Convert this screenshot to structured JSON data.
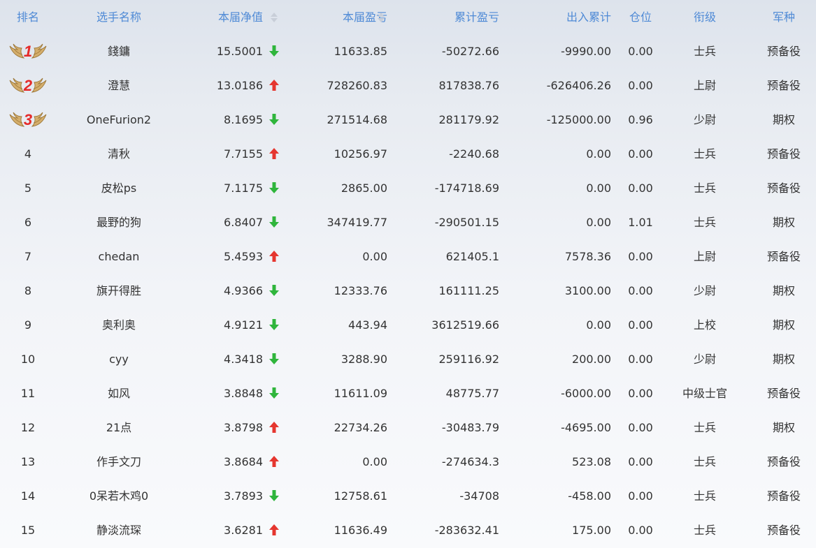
{
  "header": {
    "rank": "排名",
    "name": "选手名称",
    "nav": "本届净值",
    "pl": "本届盈亏",
    "cum": "累计盈亏",
    "io": "出入累计",
    "pos": "仓位",
    "rank_title": "衔级",
    "type": "军种"
  },
  "colors": {
    "header_text": "#4f8ad6",
    "up_arrow": "#e5362f",
    "down_arrow": "#2fb53c",
    "medal_number": "#e52a2a",
    "medal_wing": "#c9a15a"
  },
  "icons": {
    "up": "red-up-arrow-icon",
    "down": "green-down-arrow-icon",
    "sort": "sort-updown-icon",
    "medal": "winged-medal-icon"
  },
  "rows": [
    {
      "rank": "1",
      "name": "錢鏞",
      "nav": "15.5001",
      "trend": "down",
      "pl": "11633.85",
      "cum": "-50272.66",
      "io": "-9990.00",
      "pos": "0.00",
      "rank_title": "士兵",
      "type": "预备役"
    },
    {
      "rank": "2",
      "name": "澄慧",
      "nav": "13.0186",
      "trend": "up",
      "pl": "728260.83",
      "cum": "817838.76",
      "io": "-626406.26",
      "pos": "0.00",
      "rank_title": "上尉",
      "type": "预备役"
    },
    {
      "rank": "3",
      "name": "OneFurion2",
      "nav": "8.1695",
      "trend": "down",
      "pl": "271514.68",
      "cum": "281179.92",
      "io": "-125000.00",
      "pos": "0.96",
      "rank_title": "少尉",
      "type": "期权"
    },
    {
      "rank": "4",
      "name": "清秋",
      "nav": "7.7155",
      "trend": "up",
      "pl": "10256.97",
      "cum": "-2240.68",
      "io": "0.00",
      "pos": "0.00",
      "rank_title": "士兵",
      "type": "预备役"
    },
    {
      "rank": "5",
      "name": "皮松ps",
      "nav": "7.1175",
      "trend": "down",
      "pl": "2865.00",
      "cum": "-174718.69",
      "io": "0.00",
      "pos": "0.00",
      "rank_title": "士兵",
      "type": "预备役"
    },
    {
      "rank": "6",
      "name": "最野的狗",
      "nav": "6.8407",
      "trend": "down",
      "pl": "347419.77",
      "cum": "-290501.15",
      "io": "0.00",
      "pos": "1.01",
      "rank_title": "士兵",
      "type": "期权"
    },
    {
      "rank": "7",
      "name": "chedan",
      "nav": "5.4593",
      "trend": "up",
      "pl": "0.00",
      "cum": "621405.1",
      "io": "7578.36",
      "pos": "0.00",
      "rank_title": "上尉",
      "type": "预备役"
    },
    {
      "rank": "8",
      "name": "旗开得胜",
      "nav": "4.9366",
      "trend": "down",
      "pl": "12333.76",
      "cum": "161111.25",
      "io": "3100.00",
      "pos": "0.00",
      "rank_title": "少尉",
      "type": "期权"
    },
    {
      "rank": "9",
      "name": "奥利奥",
      "nav": "4.9121",
      "trend": "down",
      "pl": "443.94",
      "cum": "3612519.66",
      "io": "0.00",
      "pos": "0.00",
      "rank_title": "上校",
      "type": "期权"
    },
    {
      "rank": "10",
      "name": "cyy",
      "nav": "4.3418",
      "trend": "down",
      "pl": "3288.90",
      "cum": "259116.92",
      "io": "200.00",
      "pos": "0.00",
      "rank_title": "少尉",
      "type": "期权"
    },
    {
      "rank": "11",
      "name": "如风",
      "nav": "3.8848",
      "trend": "down",
      "pl": "11611.09",
      "cum": "48775.77",
      "io": "-6000.00",
      "pos": "0.00",
      "rank_title": "中级士官",
      "type": "预备役"
    },
    {
      "rank": "12",
      "name": "21点",
      "nav": "3.8798",
      "trend": "up",
      "pl": "22734.26",
      "cum": "-30483.79",
      "io": "-4695.00",
      "pos": "0.00",
      "rank_title": "士兵",
      "type": "期权"
    },
    {
      "rank": "13",
      "name": "作手文刀",
      "nav": "3.8684",
      "trend": "up",
      "pl": "0.00",
      "cum": "-274634.3",
      "io": "523.08",
      "pos": "0.00",
      "rank_title": "士兵",
      "type": "预备役"
    },
    {
      "rank": "14",
      "name": "0呆若木鸡0",
      "nav": "3.7893",
      "trend": "down",
      "pl": "12758.61",
      "cum": "-34708",
      "io": "-458.00",
      "pos": "0.00",
      "rank_title": "士兵",
      "type": "预备役"
    },
    {
      "rank": "15",
      "name": "静淡流琛",
      "nav": "3.6281",
      "trend": "up",
      "pl": "11636.49",
      "cum": "-283632.41",
      "io": "175.00",
      "pos": "0.00",
      "rank_title": "士兵",
      "type": "预备役"
    }
  ]
}
